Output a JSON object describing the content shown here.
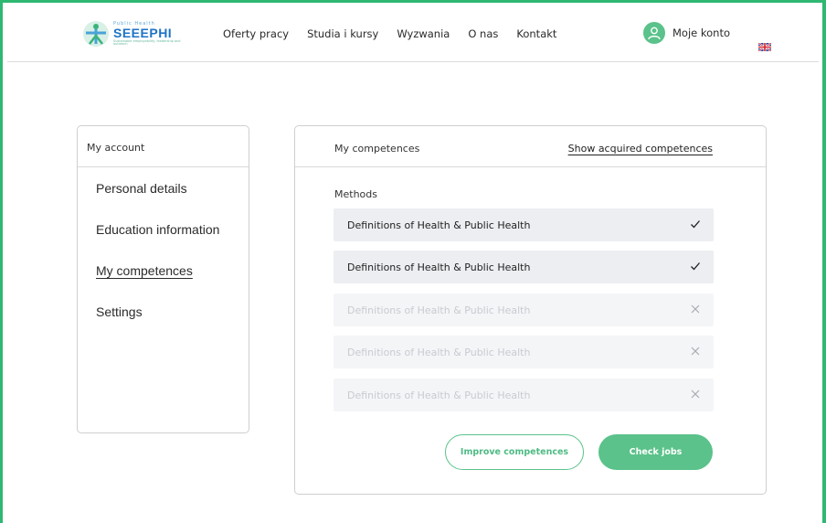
{
  "brand": {
    "small": "Public Health",
    "name": "SEEEPHI",
    "tagline": "Sustainable employability, leadership and outreach"
  },
  "nav": {
    "items": [
      "Oferty pracy",
      "Studia i kursy",
      "Wyzwania",
      "O nas",
      "Kontakt"
    ],
    "account_label": "Moje konto",
    "language_icon": "uk-flag-icon"
  },
  "sidebar": {
    "title": "My account",
    "items": [
      {
        "label": "Personal details"
      },
      {
        "label": "Education information"
      },
      {
        "label": "My competences"
      },
      {
        "label": "Settings"
      }
    ],
    "active": "My competences"
  },
  "main": {
    "title": "My competences",
    "show_link": "Show acquired competences",
    "section": "Methods",
    "competences": [
      {
        "label": "Definitions of Health & Public Health",
        "status": "acquired"
      },
      {
        "label": "Definitions of Health & Public Health",
        "status": "acquired"
      },
      {
        "label": "Definitions of Health & Public Health",
        "status": "not acquired"
      },
      {
        "label": "Definitions of Health & Public Health",
        "status": "not acquired"
      },
      {
        "label": "Definitions of Health & Public Health",
        "status": "not acquired"
      }
    ],
    "improve_button": "Improve competences",
    "check_button": "Check jobs"
  },
  "colors": {
    "accent": "#5ac28a",
    "frame": "#2eb872",
    "row_done": "#eceef1",
    "row_pending": "#f4f5f7"
  }
}
